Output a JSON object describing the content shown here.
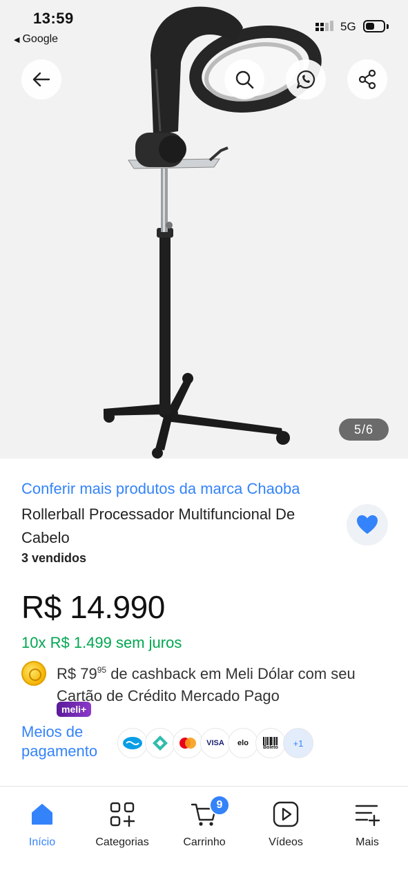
{
  "status_bar": {
    "time": "13:59",
    "back_app": "Google",
    "network": "5G"
  },
  "gallery": {
    "counter": "5/6",
    "buttons": [
      "back-arrow-icon",
      "search-icon",
      "whatsapp-icon",
      "share-icon"
    ]
  },
  "product": {
    "brand_link": "Conferir mais produtos da marca Chaoba",
    "title": "Rollerball Processador Multifuncional De Cabelo",
    "sold": "3 vendidos",
    "price": "R$ 14.990",
    "installments": "10x R$ 1.499 sem juros",
    "cashback_prefix": "R$ 79",
    "cashback_cents": "95",
    "cashback_suffix": " de cashback em Meli Dólar com seu Cartão de Crédito Mercado Pago",
    "meli_badge": "meli+",
    "payment_label": "Meios de pagamento",
    "payment_methods": [
      "Mercado Pago",
      "Pix",
      "Mastercard",
      "VISA",
      "elo",
      "Boleto"
    ],
    "payment_more": "+1"
  },
  "colors": {
    "accent_blue": "#3483fa",
    "green": "#00a650"
  },
  "bottom_nav": {
    "items": [
      {
        "label": "Início",
        "icon": "home-icon",
        "active": true
      },
      {
        "label": "Categorias",
        "icon": "categories-icon"
      },
      {
        "label": "Carrinho",
        "icon": "cart-icon",
        "badge": "9"
      },
      {
        "label": "Vídeos",
        "icon": "video-icon"
      },
      {
        "label": "Mais",
        "icon": "more-menu-icon"
      }
    ]
  }
}
